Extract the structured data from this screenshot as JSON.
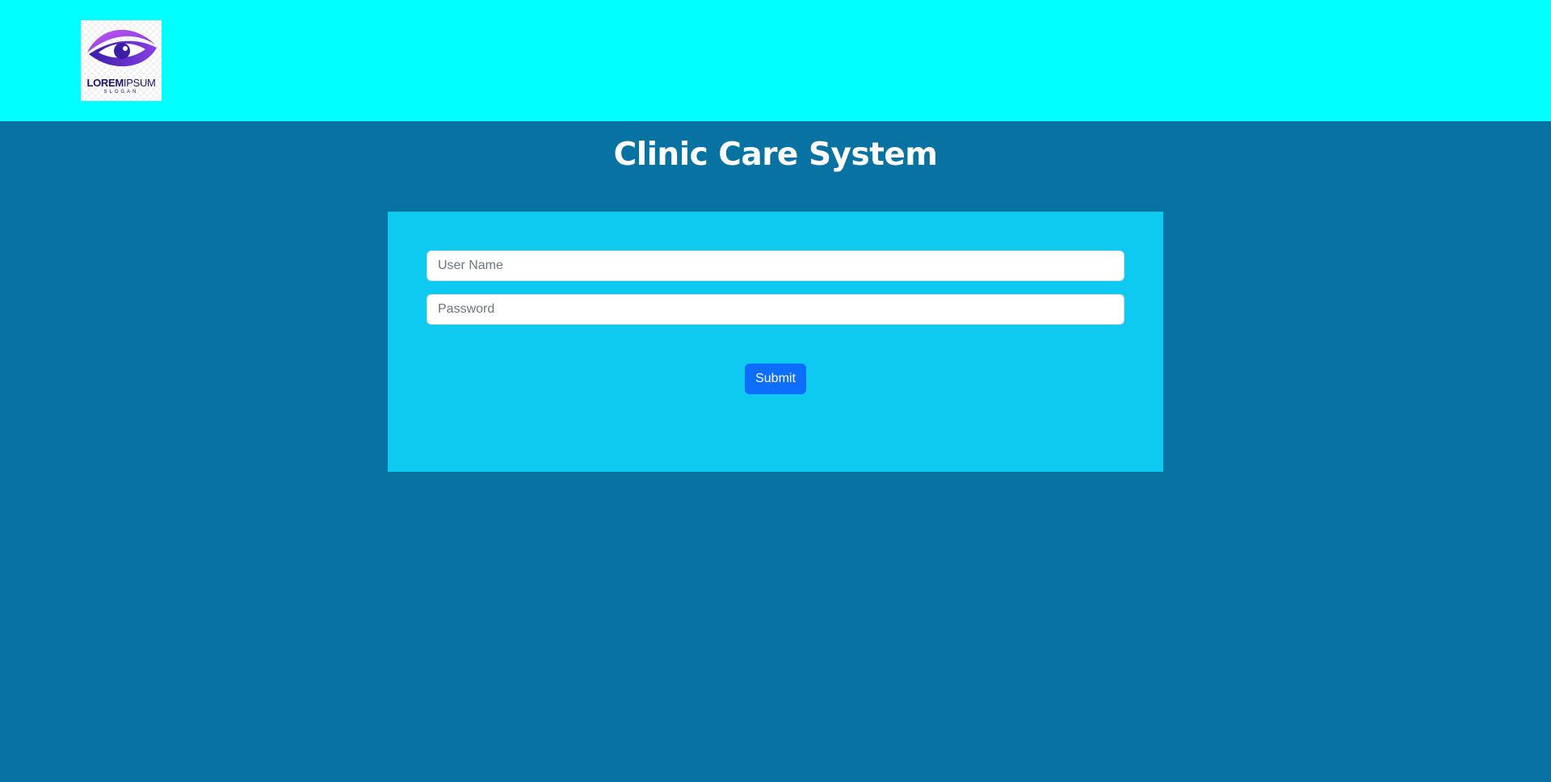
{
  "header": {
    "logo": {
      "brand_bold": "LOREM",
      "brand_light": "IPSUM",
      "slogan": "SLOGAN",
      "icon": "eye-logo-icon"
    },
    "background_color": "#00ffff"
  },
  "page": {
    "title": "Clinic Care System",
    "background_color": "#0873a2"
  },
  "login_form": {
    "background_color": "#0fcaf0",
    "username_placeholder": "User Name",
    "username_value": "",
    "password_placeholder": "Password",
    "password_value": "",
    "submit_label": "Submit",
    "submit_color": "#0d6efd"
  }
}
